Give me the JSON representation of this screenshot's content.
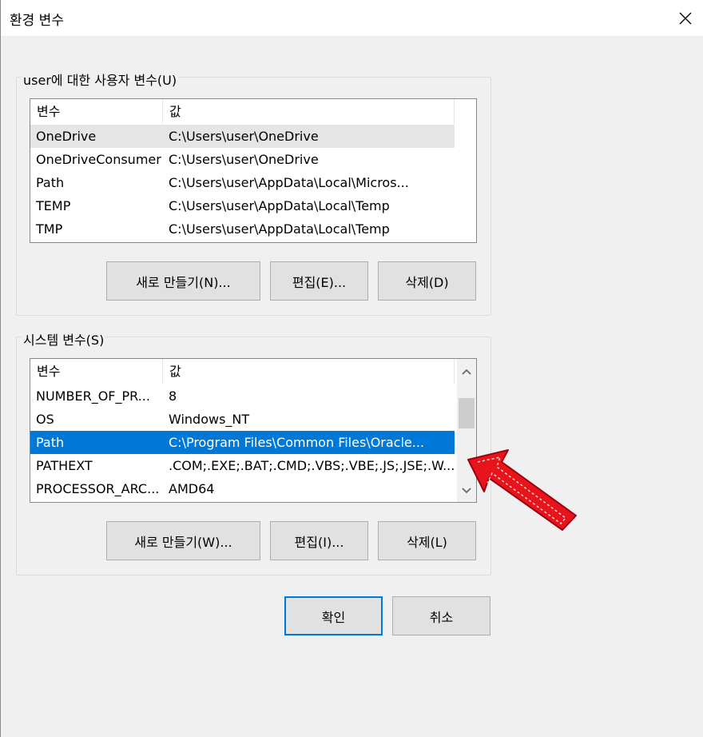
{
  "window": {
    "title": "환경 변수",
    "close_icon": "close-icon"
  },
  "user_vars": {
    "group_title": "user에 대한 사용자 변수(U)",
    "columns": [
      "변수",
      "값"
    ],
    "rows": [
      {
        "name": "OneDrive",
        "value": "C:\\Users\\user\\OneDrive",
        "state": "hover"
      },
      {
        "name": "OneDriveConsumer",
        "value": "C:\\Users\\user\\OneDrive",
        "state": ""
      },
      {
        "name": "Path",
        "value": "C:\\Users\\user\\AppData\\Local\\Micros...",
        "state": ""
      },
      {
        "name": "TEMP",
        "value": "C:\\Users\\user\\AppData\\Local\\Temp",
        "state": ""
      },
      {
        "name": "TMP",
        "value": "C:\\Users\\user\\AppData\\Local\\Temp",
        "state": ""
      }
    ],
    "buttons": {
      "new": "새로 만들기(N)...",
      "edit": "편집(E)...",
      "delete": "삭제(D)"
    }
  },
  "system_vars": {
    "group_title": "시스템 변수(S)",
    "columns": [
      "변수",
      "값"
    ],
    "rows": [
      {
        "name": "NUMBER_OF_PR...",
        "value": "8",
        "state": ""
      },
      {
        "name": "OS",
        "value": "Windows_NT",
        "state": ""
      },
      {
        "name": "Path",
        "value": "C:\\Program Files\\Common Files\\Oracle...",
        "state": "selected"
      },
      {
        "name": "PATHEXT",
        "value": ".COM;.EXE;.BAT;.CMD;.VBS;.VBE;.JS;.JSE;.W...",
        "state": ""
      },
      {
        "name": "PROCESSOR_ARC...",
        "value": "AMD64",
        "state": ""
      }
    ],
    "buttons": {
      "new": "새로 만들기(W)...",
      "edit": "편집(I)...",
      "delete": "삭제(L)"
    }
  },
  "dialog_buttons": {
    "ok": "확인",
    "cancel": "취소"
  },
  "colors": {
    "selection": "#0078d7",
    "annotation_arrow": "#e8141c"
  }
}
